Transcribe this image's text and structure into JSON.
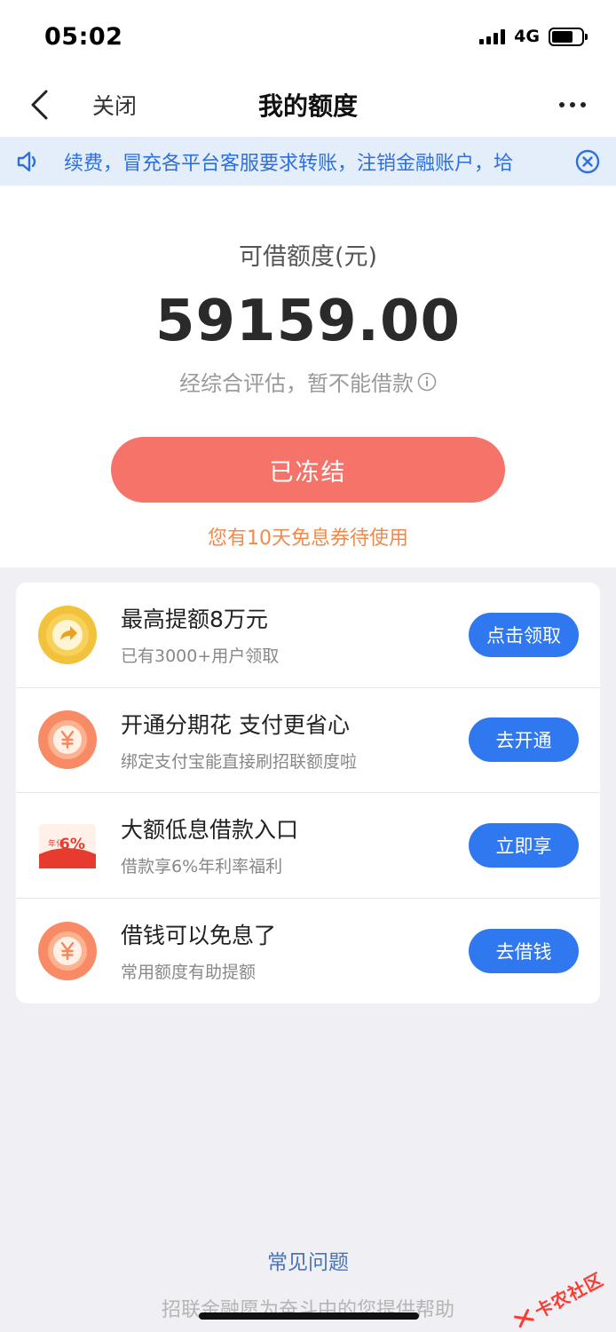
{
  "status_bar": {
    "time": "05:02",
    "network": "4G"
  },
  "nav": {
    "close_label": "关闭",
    "title": "我的额度"
  },
  "notice": {
    "text": "续费，冒充各平台客服要求转账，注销金融账户，垥"
  },
  "quota": {
    "label": "可借额度(元)",
    "amount": "59159.00",
    "sub": "经综合评估，暂不能借款",
    "button": "已冻结",
    "coupon": "您有10天免息券待使用"
  },
  "offers": [
    {
      "title": "最高提额8万元",
      "desc": "已有3000+用户领取",
      "button": "点击领取",
      "icon": "arrow-coin-icon"
    },
    {
      "title": "开通分期花 支付更省心",
      "desc": "绑定支付宝能直接刷招联额度啦",
      "button": "去开通",
      "icon": "yuan-coin-icon"
    },
    {
      "title": "大额低息借款入口",
      "desc": "借款享6%年利率福利",
      "button": "立即享",
      "icon": "red-envelope-icon",
      "badge_text": "6%",
      "badge_small": "年化"
    },
    {
      "title": "借钱可以免息了",
      "desc": "常用额度有助提额",
      "button": "去借钱",
      "icon": "yuan-coin-icon"
    }
  ],
  "footer": {
    "faq": "常见问题",
    "slogan": "招联金融愿为奋斗中的您提供帮助"
  },
  "watermark": {
    "text": "卡农社区"
  },
  "colors": {
    "accent_blue": "#2f78f0",
    "frozen_red": "#f6736a",
    "coupon_orange": "#f08a4b"
  }
}
